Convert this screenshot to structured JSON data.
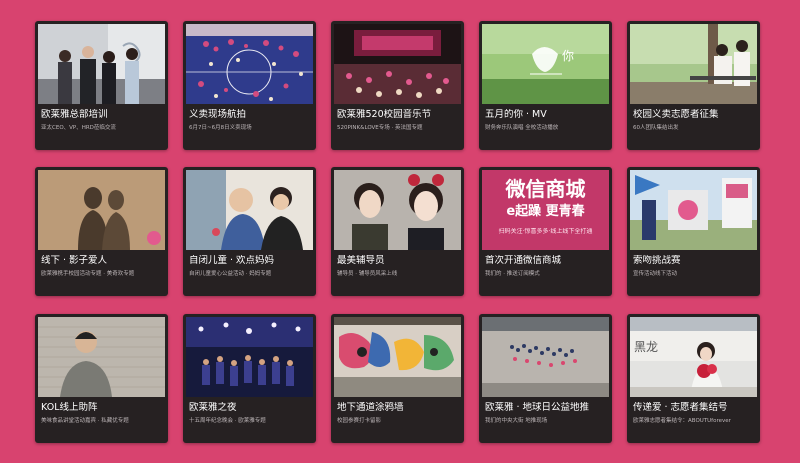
{
  "background_color": "#d8436f",
  "card_color": "#262122",
  "cards": [
    {
      "title": "欧莱雅总部培训",
      "subtitle": "亚太CEO、VP、HRD莅临交流",
      "image": "group-photo"
    },
    {
      "title": "义卖现场航拍",
      "subtitle": "6月7日~6月8日义卖现场",
      "image": "aerial-crowd"
    },
    {
      "title": "欧莱雅520校园音乐节",
      "subtitle": "520PINK&LOVE专场 · 英法国专题",
      "image": "stage-concert"
    },
    {
      "title": "五月的你 · MV",
      "subtitle": "财务奔乐队演唱 全校活动播放",
      "image": "green-field-mv"
    },
    {
      "title": "校园义卖志愿者征集",
      "subtitle": "60人团队集结出发",
      "image": "campus-bench"
    },
    {
      "title": "线下 · 影子爱人",
      "subtitle": "欧莱雅携手校园活动专题 · 美奇欢专题",
      "image": "shadow-couple"
    },
    {
      "title": "自闭儿童 · 欢点妈妈",
      "subtitle": "自闭儿童爱心公益活动 · 妈妈专题",
      "image": "mother-child"
    },
    {
      "title": "最美辅导员",
      "subtitle": "辅导员 · 辅导员风采上线",
      "image": "two-women-selfie"
    },
    {
      "title": "首次开通微信商城",
      "subtitle": "我们的 · 推送订阅模式",
      "image": "wechat-mall-banner"
    },
    {
      "title": "索吻挑战赛",
      "subtitle": "宣传活动线下活动",
      "image": "campus-signboard"
    },
    {
      "title": "KOL线上助阵",
      "subtitle": "美味食品讲堂活动嘉宾 · 私藏优专题",
      "image": "man-brick-wall"
    },
    {
      "title": "欧莱雅之夜",
      "subtitle": "十五周年纪念晚会 · 欧莱雅专题",
      "image": "night-stage"
    },
    {
      "title": "地下通道涂鸦墙",
      "subtitle": "校园参赛打卡留影",
      "image": "graffiti-wall"
    },
    {
      "title": "欧莱雅 · 地球日公益地推",
      "subtitle": "我们的中央大街 地推现场",
      "image": "aerial-earthday"
    },
    {
      "title": "传递爱 · 志愿者集结号",
      "subtitle": "欧莱雅志愿者集结令：ABOUTUforever",
      "image": "girl-flowers"
    }
  ],
  "banner": {
    "line1": "微信商城",
    "line2": "e起躁 更青春",
    "line3": "扫码关注·惊喜多多·线上线下全打通"
  },
  "mv_logo_text": "你",
  "sign_text": "黑龙"
}
